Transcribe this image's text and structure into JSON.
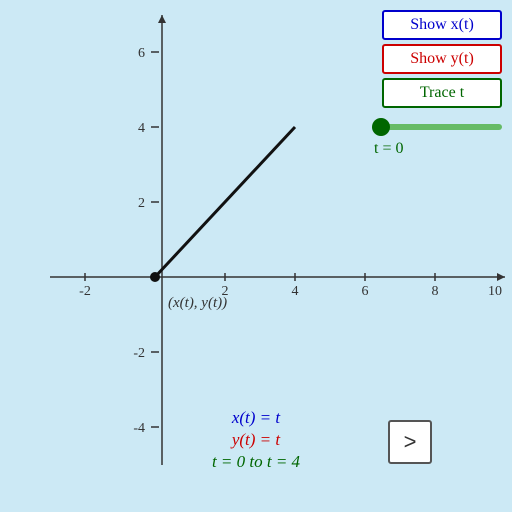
{
  "buttons": {
    "show_x_label": "Show x(t)",
    "show_y_label": "Show y(t)",
    "trace_label": "Trace t"
  },
  "slider": {
    "t_value": 0,
    "t_min": 0,
    "t_max": 4,
    "t_display": "t = 0"
  },
  "formulas": {
    "fx": "x(t) = t",
    "fy": "y(t) = t",
    "ft": "t = 0 to t = 4"
  },
  "next_button_label": ">",
  "point_label": "(x(t), y(t))",
  "graph": {
    "x_min": -3,
    "x_max": 10,
    "y_min": -5,
    "y_max": 7,
    "line_start": [
      0,
      0
    ],
    "line_end": [
      4,
      4
    ]
  }
}
